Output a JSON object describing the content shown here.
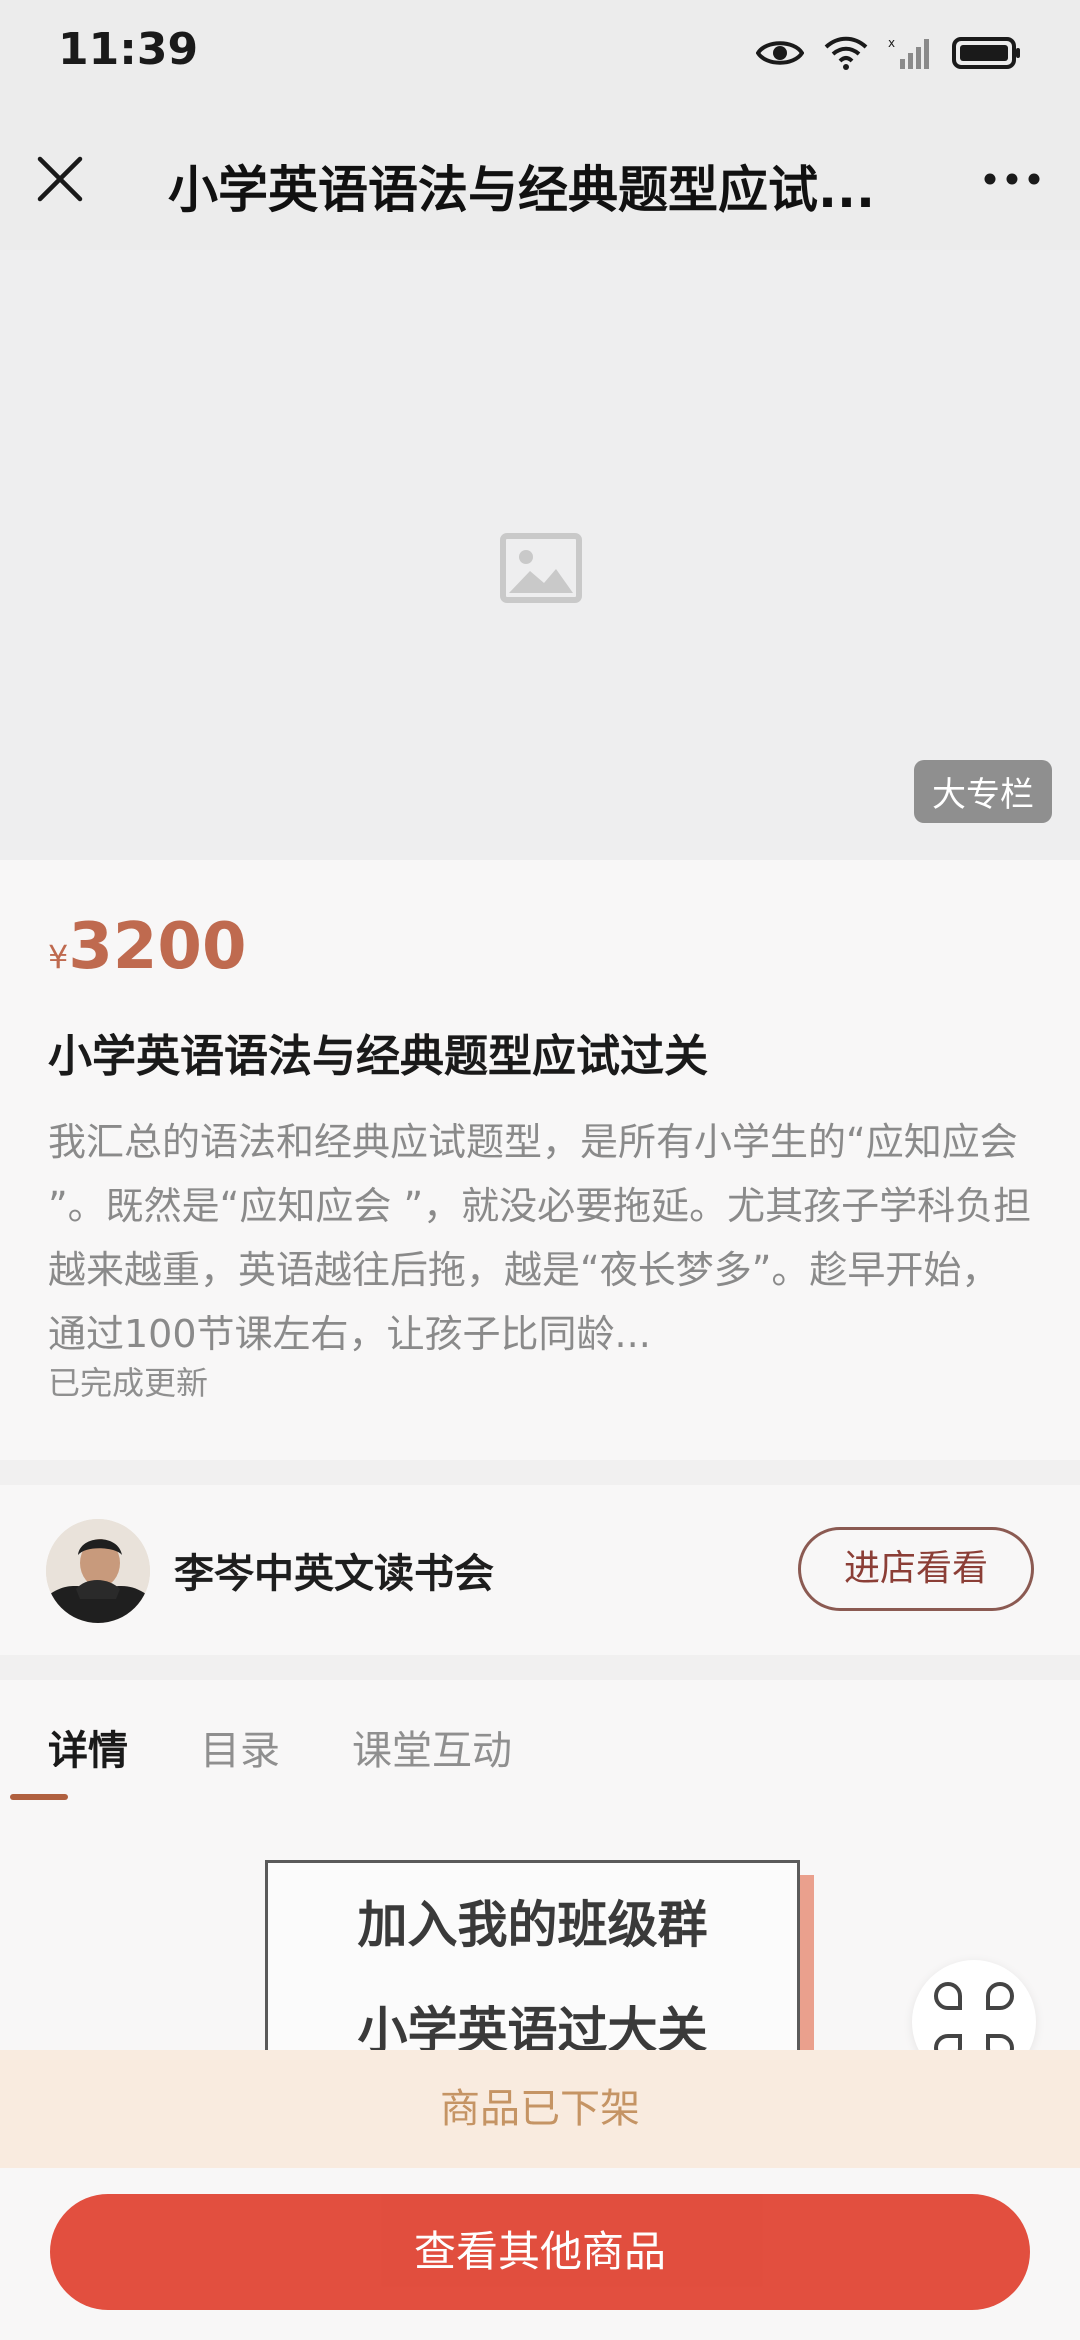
{
  "status_bar": {
    "time": "11:39",
    "icons": [
      "eye-icon",
      "wifi-icon",
      "signal-icon",
      "battery-icon"
    ]
  },
  "nav": {
    "title": "小学英语语法与经典题型应试...",
    "close_icon": "close-icon",
    "more_icon": "more-icon"
  },
  "cover": {
    "placeholder_icon": "image-placeholder-icon",
    "badge": "大专栏"
  },
  "product": {
    "currency": "¥",
    "price": "3200",
    "title": "小学英语语法与经典题型应试过关",
    "description": "我汇总的语法和经典应试题型，是所有小学生的“应知应会 ”。既然是“应知应会 ”，就没必要拖延。尤其孩子学科负担越来越重，英语越往后拖，越是“夜长梦多”。趁早开始，通过100节课左右，让孩子比同龄...",
    "update_status": "已完成更新"
  },
  "shop": {
    "name": "李岑中英文读书会",
    "visit_button": "进店看看"
  },
  "tabs": [
    {
      "label": "详情",
      "active": true
    },
    {
      "label": "目录",
      "active": false
    },
    {
      "label": "课堂互动",
      "active": false
    }
  ],
  "poster": {
    "line1": "加入我的班级群",
    "line2": "小学英语过大关"
  },
  "offline_notice": "商品已下架",
  "cta_button": "查看其他商品",
  "colors": {
    "price": "#bf6a4f",
    "cta": "#e0402f",
    "offline_bg": "#f9ebdf",
    "offline_text": "#c59464",
    "tab_underline": "#b0603f"
  }
}
